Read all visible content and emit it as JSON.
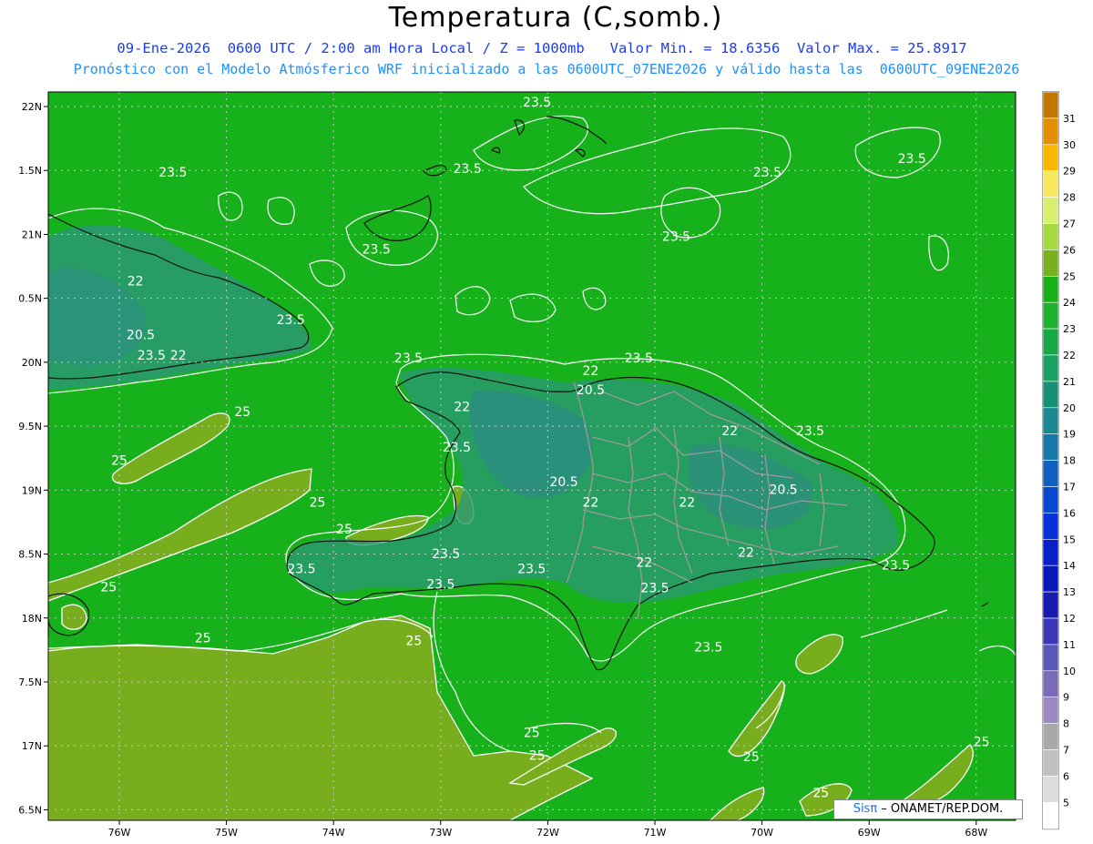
{
  "header": {
    "title": "Temperatura (C,somb.)",
    "subtitle_1": "09-Ene-2026  0600 UTC / 2:00 am Hora Local / Z = 1000mb   Valor Min. = 18.6356  Valor Max. = 25.8917",
    "subtitle_2": "Pronóstico con el Modelo Atmósferico WRF inicializado a las 0600UTC_07ENE2026 y válido hasta las  0600UTC_09ENE2026"
  },
  "axes": {
    "lon_labels": [
      "76W",
      "75W",
      "74W",
      "73W",
      "72W",
      "71W",
      "70W",
      "69W",
      "68W"
    ],
    "lat_labels": [
      "22N",
      "1.5N",
      "21N",
      "0.5N",
      "20N",
      "9.5N",
      "19N",
      "8.5N",
      "18N",
      "7.5N",
      "17N",
      "6.5N"
    ]
  },
  "colorbar": {
    "levels": [
      {
        "label": "31",
        "color": "#c07800"
      },
      {
        "label": "30",
        "color": "#e09000"
      },
      {
        "label": "29",
        "color": "#f8b800"
      },
      {
        "label": "28",
        "color": "#f8e860"
      },
      {
        "label": "27",
        "color": "#d8f070"
      },
      {
        "label": "26",
        "color": "#a8d840"
      },
      {
        "label": "25",
        "color": "#78b020"
      },
      {
        "label": "24",
        "color": "#18b018"
      },
      {
        "label": "23",
        "color": "#20b030"
      },
      {
        "label": "22",
        "color": "#18a848"
      },
      {
        "label": "21",
        "color": "#1aa060"
      },
      {
        "label": "20",
        "color": "#189078"
      },
      {
        "label": "19",
        "color": "#1a8890"
      },
      {
        "label": "18",
        "color": "#1878a8"
      },
      {
        "label": "17",
        "color": "#1060c0"
      },
      {
        "label": "16",
        "color": "#0848d0"
      },
      {
        "label": "15",
        "color": "#0830d8"
      },
      {
        "label": "14",
        "color": "#0820c8"
      },
      {
        "label": "13",
        "color": "#0818b8"
      },
      {
        "label": "12",
        "color": "#1a1ab0"
      },
      {
        "label": "11",
        "color": "#3a3ab8"
      },
      {
        "label": "10",
        "color": "#5858b8"
      },
      {
        "label": "9",
        "color": "#7a6ab8"
      },
      {
        "label": "8",
        "color": "#9a8ac0"
      },
      {
        "label": "7",
        "color": "#a8a8a8"
      },
      {
        "label": "6",
        "color": "#c0c0c0"
      },
      {
        "label": "5",
        "color": "#dcdcdc"
      },
      {
        "label": "",
        "color": "#ffffff"
      }
    ]
  },
  "contour_labels": [
    {
      "text": "23.5",
      "lon": -72.1,
      "lat": 22.0
    },
    {
      "text": "23.5",
      "lon": -75.5,
      "lat": 21.45
    },
    {
      "text": "23.5",
      "lon": -72.75,
      "lat": 21.48
    },
    {
      "text": "23.5",
      "lon": -69.95,
      "lat": 21.45
    },
    {
      "text": "23.5",
      "lon": -68.6,
      "lat": 21.56
    },
    {
      "text": "23.5",
      "lon": -70.8,
      "lat": 20.95
    },
    {
      "text": "23.5",
      "lon": -73.6,
      "lat": 20.85
    },
    {
      "text": "22",
      "lon": -75.85,
      "lat": 20.6
    },
    {
      "text": "23.5",
      "lon": -74.4,
      "lat": 20.3
    },
    {
      "text": "20.5",
      "lon": -75.8,
      "lat": 20.18
    },
    {
      "text": "23.5",
      "lon": -75.7,
      "lat": 20.02
    },
    {
      "text": "22",
      "lon": -75.45,
      "lat": 20.02
    },
    {
      "text": "23.5",
      "lon": -73.3,
      "lat": 20.0
    },
    {
      "text": "23.5",
      "lon": -71.15,
      "lat": 20.0
    },
    {
      "text": "22",
      "lon": -71.6,
      "lat": 19.9
    },
    {
      "text": "20.5",
      "lon": -71.6,
      "lat": 19.75
    },
    {
      "text": "22",
      "lon": -72.8,
      "lat": 19.62
    },
    {
      "text": "25",
      "lon": -74.85,
      "lat": 19.58
    },
    {
      "text": "22",
      "lon": -70.3,
      "lat": 19.43
    },
    {
      "text": "23.5",
      "lon": -69.55,
      "lat": 19.43
    },
    {
      "text": "23.5",
      "lon": -72.85,
      "lat": 19.3
    },
    {
      "text": "25",
      "lon": -76.0,
      "lat": 19.2
    },
    {
      "text": "20.5",
      "lon": -71.85,
      "lat": 19.03
    },
    {
      "text": "20.5",
      "lon": -69.8,
      "lat": 18.97
    },
    {
      "text": "22",
      "lon": -71.6,
      "lat": 18.87
    },
    {
      "text": "22",
      "lon": -70.7,
      "lat": 18.87
    },
    {
      "text": "25",
      "lon": -74.15,
      "lat": 18.87
    },
    {
      "text": "25",
      "lon": -73.9,
      "lat": 18.66
    },
    {
      "text": "23.5",
      "lon": -72.95,
      "lat": 18.47
    },
    {
      "text": "22",
      "lon": -70.15,
      "lat": 18.48
    },
    {
      "text": "22",
      "lon": -71.1,
      "lat": 18.4
    },
    {
      "text": "23.5",
      "lon": -72.15,
      "lat": 18.35
    },
    {
      "text": "23.5",
      "lon": -74.3,
      "lat": 18.35
    },
    {
      "text": "23.5",
      "lon": -68.75,
      "lat": 18.38
    },
    {
      "text": "23.5",
      "lon": -73.0,
      "lat": 18.23
    },
    {
      "text": "25",
      "lon": -76.1,
      "lat": 18.21
    },
    {
      "text": "23.5",
      "lon": -71.0,
      "lat": 18.2
    },
    {
      "text": "25",
      "lon": -75.22,
      "lat": 17.81
    },
    {
      "text": "25",
      "lon": -73.25,
      "lat": 17.79
    },
    {
      "text": "23.5",
      "lon": -70.5,
      "lat": 17.74
    },
    {
      "text": "25",
      "lon": -72.15,
      "lat": 17.07
    },
    {
      "text": "25",
      "lon": -72.1,
      "lat": 16.89
    },
    {
      "text": "25",
      "lon": -70.1,
      "lat": 16.88
    },
    {
      "text": "25",
      "lon": -67.95,
      "lat": 17.0
    },
    {
      "text": "25",
      "lon": -69.45,
      "lat": 16.6
    }
  ],
  "credit": {
    "sis": "Sisπ",
    "text": " – ONAMET/REP.DOM."
  }
}
